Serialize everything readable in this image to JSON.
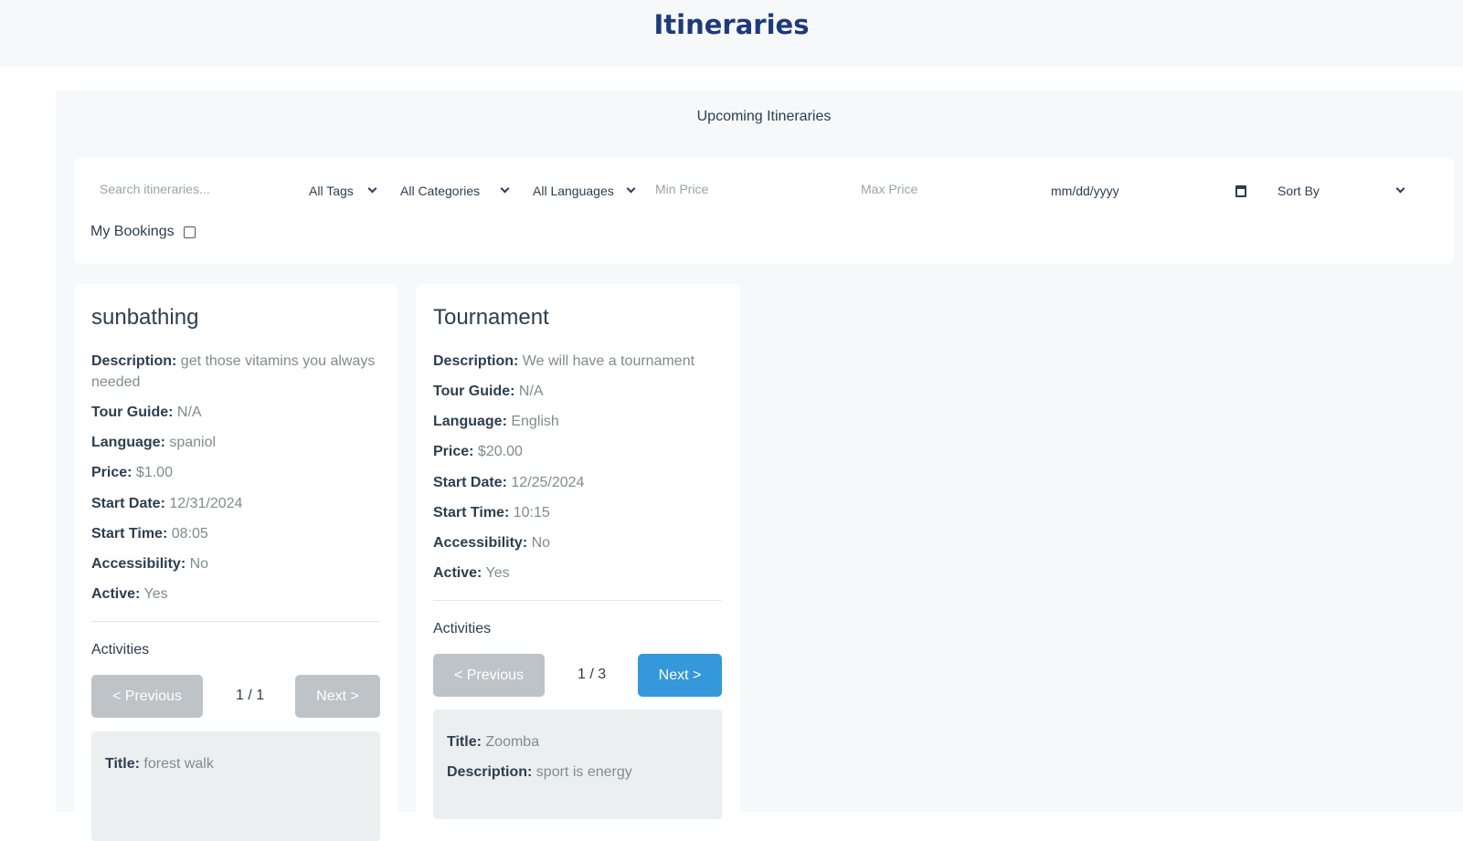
{
  "header": {
    "title": "Itineraries"
  },
  "section": {
    "title": "Upcoming Itineraries"
  },
  "filters": {
    "search_placeholder": "Search itineraries...",
    "tags": "All Tags",
    "categories": "All Categories",
    "languages": "All Languages",
    "min_price_placeholder": "Min Price",
    "max_price_placeholder": "Max Price",
    "date_placeholder": "mm/dd/yyyy",
    "sort_by": "Sort By",
    "my_bookings": "My Bookings"
  },
  "labels": {
    "description": "Description:",
    "tour_guide": "Tour Guide:",
    "language": "Language:",
    "price": "Price:",
    "start_date": "Start Date:",
    "start_time": "Start Time:",
    "accessibility": "Accessibility:",
    "active": "Active:",
    "activities": "Activities",
    "previous": "< Previous",
    "next": "Next >",
    "title": "Title:"
  },
  "cards": [
    {
      "title": "sunbathing",
      "description": "get those vitamins you always needed",
      "tour_guide": "N/A",
      "language": "spaniol",
      "price": "$1.00",
      "start_date": "12/31/2024",
      "start_time": "08:05",
      "accessibility": "No",
      "active": "Yes",
      "pagination": "1 / 1",
      "activity": {
        "title": "forest walk",
        "description": ""
      }
    },
    {
      "title": "Tournament",
      "description": "We will have a tournament",
      "tour_guide": "N/A",
      "language": "English",
      "price": "$20.00",
      "start_date": "12/25/2024",
      "start_time": "10:15",
      "accessibility": "No",
      "active": "Yes",
      "pagination": "1 / 3",
      "activity": {
        "title": "Zoomba",
        "description": "sport is energy"
      }
    }
  ],
  "colors": {
    "title": "#1e3a7b",
    "button_enabled": "#3498db",
    "button_disabled": "#bdc3c7"
  }
}
